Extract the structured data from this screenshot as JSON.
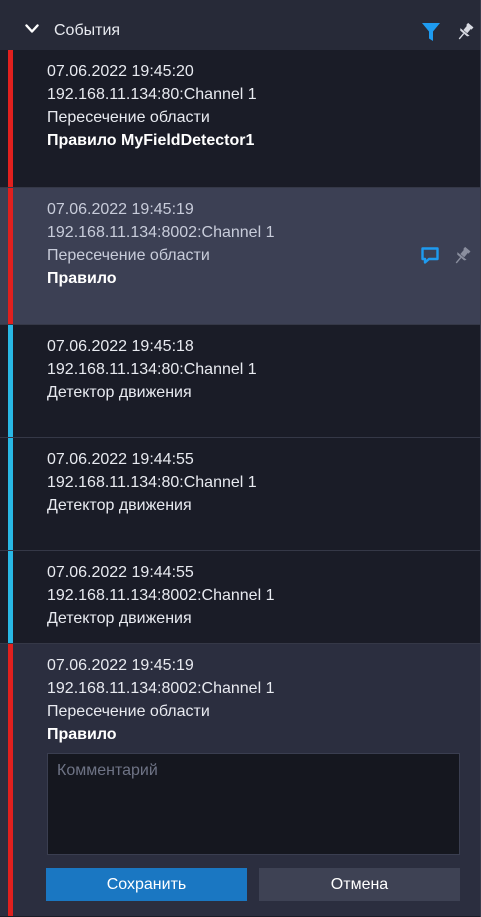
{
  "header": {
    "title": "События",
    "accent_color": "#1e9bf0"
  },
  "events": [
    {
      "datetime": "07.06.2022 19:45:20",
      "source": "192.168.11.134:80:Channel 1",
      "type": "Пересечение области",
      "rule": "Правило MyFieldDetector1",
      "stripe_color": "#e0201e"
    },
    {
      "datetime": "07.06.2022 19:45:19",
      "source": "192.168.11.134:8002:Channel 1",
      "type": "Пересечение области",
      "rule": "Правило",
      "stripe_color": "#e0201e",
      "icons": [
        "comment-icon",
        "pin-icon"
      ]
    },
    {
      "datetime": "07.06.2022 19:45:18",
      "source": "192.168.11.134:80:Channel 1",
      "type": "Детектор движения",
      "stripe_color": "#29b8e5"
    },
    {
      "datetime": "07.06.2022 19:44:55",
      "source": "192.168.11.134:80:Channel 1",
      "type": "Детектор движения",
      "stripe_color": "#29b8e5"
    },
    {
      "datetime": "07.06.2022 19:44:55",
      "source": "192.168.11.134:8002:Channel 1",
      "type": "Детектор движения",
      "stripe_color": "#29b8e5"
    },
    {
      "datetime": "07.06.2022 19:45:19",
      "source": "192.168.11.134:8002:Channel 1",
      "type": "Пересечение области",
      "rule": "Правило",
      "stripe_color": "#e0201e"
    }
  ],
  "comment_form": {
    "placeholder": "Комментарий",
    "value": "",
    "save_label": "Сохранить",
    "cancel_label": "Отмена"
  }
}
